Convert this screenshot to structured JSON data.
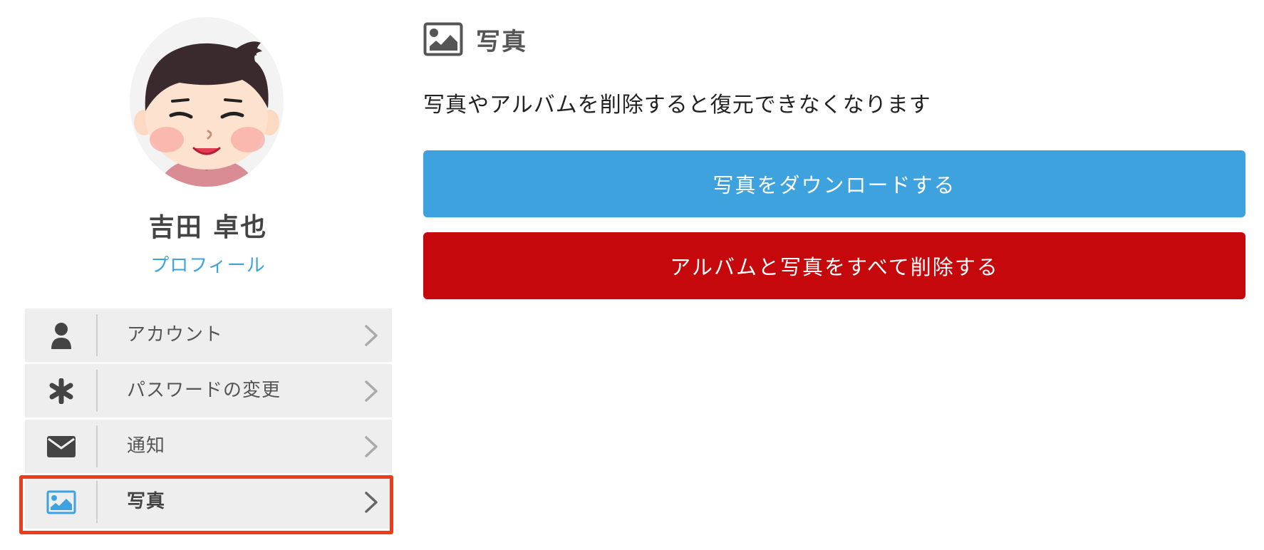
{
  "user": {
    "name": "吉田 卓也",
    "profile_link": "プロフィール"
  },
  "menu": {
    "items": [
      {
        "label": "アカウント",
        "icon": "user-icon",
        "active": false
      },
      {
        "label": "パスワードの変更",
        "icon": "asterisk-icon",
        "active": false
      },
      {
        "label": "通知",
        "icon": "envelope-icon",
        "active": false
      },
      {
        "label": "写真",
        "icon": "image-icon",
        "active": true
      }
    ]
  },
  "section": {
    "title": "写真",
    "icon": "image-icon",
    "warning": "写真やアルバムを削除すると復元できなくなります"
  },
  "actions": {
    "download_label": "写真をダウンロードする",
    "delete_label": "アルバムと写真をすべて削除する"
  },
  "colors": {
    "link": "#3fa3d9",
    "download_button": "#3da2dd",
    "delete_button": "#c4080b",
    "highlight_border": "#f03b1a",
    "menu_background": "#eeeeee"
  }
}
